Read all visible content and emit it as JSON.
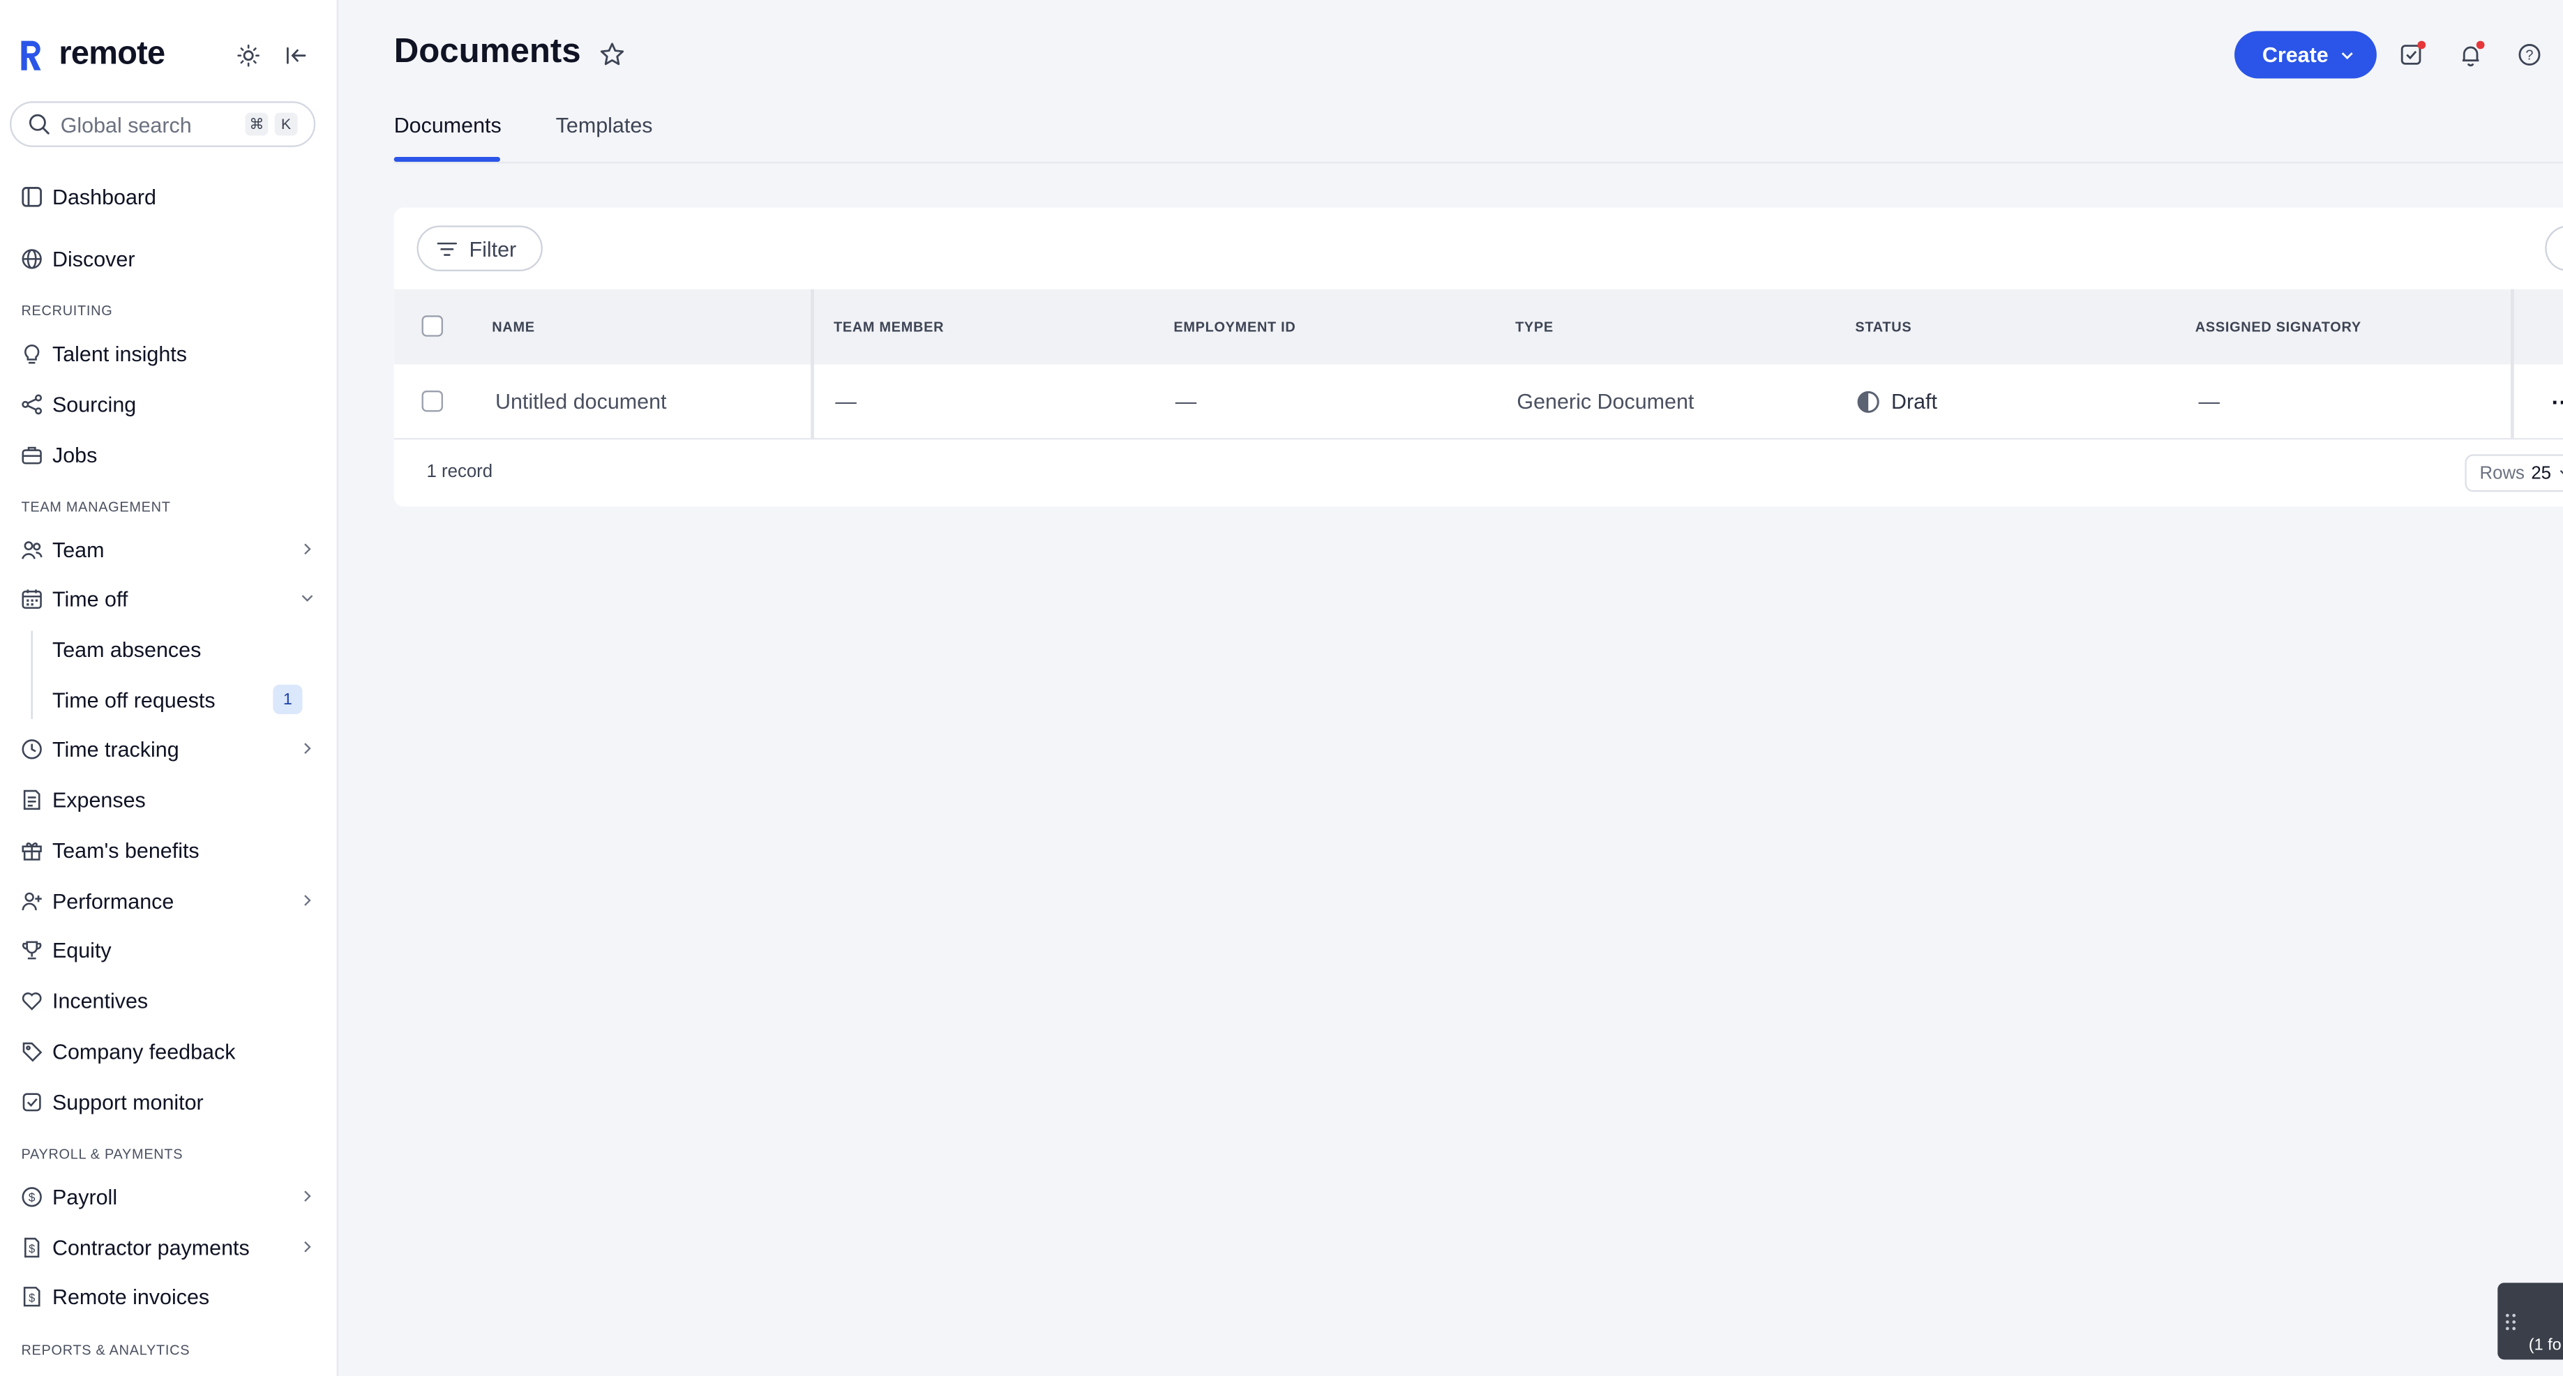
{
  "app": {
    "brand": "remote",
    "colors": {
      "accent": "#2a55e8",
      "sidebar_bg": "#ffffff",
      "page_bg": "#f4f5f8",
      "badge_bg": "#dbe7fb",
      "notification_dot": "#e5373a"
    }
  },
  "search": {
    "placeholder": "Global search",
    "shortcut_cmd": "⌘",
    "shortcut_key": "K"
  },
  "sidebar": {
    "top_items": [
      {
        "label": "Dashboard",
        "icon": "dashboard-icon"
      },
      {
        "label": "Discover",
        "icon": "globe-icon"
      }
    ],
    "sections": [
      {
        "title": "RECRUITING",
        "items": [
          {
            "label": "Talent insights",
            "icon": "lightbulb-icon"
          },
          {
            "label": "Sourcing",
            "icon": "share-icon"
          },
          {
            "label": "Jobs",
            "icon": "briefcase-icon"
          }
        ]
      },
      {
        "title": "TEAM MANAGEMENT",
        "items": [
          {
            "label": "Team",
            "icon": "people-icon",
            "chevron": "right"
          },
          {
            "label": "Time off",
            "icon": "calendar-icon",
            "chevron": "down",
            "expanded": true,
            "children": [
              {
                "label": "Team absences"
              },
              {
                "label": "Time off requests",
                "badge": "1"
              }
            ]
          },
          {
            "label": "Time tracking",
            "icon": "clock-icon",
            "chevron": "right"
          },
          {
            "label": "Expenses",
            "icon": "receipt-icon"
          },
          {
            "label": "Team's benefits",
            "icon": "gift-icon"
          },
          {
            "label": "Performance",
            "icon": "user-plus-icon",
            "chevron": "right"
          },
          {
            "label": "Equity",
            "icon": "trophy-icon"
          },
          {
            "label": "Incentives",
            "icon": "heart-icon"
          },
          {
            "label": "Company feedback",
            "icon": "tag-icon"
          },
          {
            "label": "Support monitor",
            "icon": "monitor-icon"
          }
        ]
      },
      {
        "title": "PAYROLL & PAYMENTS",
        "items": [
          {
            "label": "Payroll",
            "icon": "dollar-circle-icon",
            "chevron": "right"
          },
          {
            "label": "Contractor payments",
            "icon": "dollar-doc-icon",
            "chevron": "right"
          },
          {
            "label": "Remote invoices",
            "icon": "invoice-icon"
          }
        ]
      },
      {
        "title": "REPORTS & ANALYTICS",
        "items": []
      }
    ]
  },
  "header": {
    "title": "Documents",
    "create_label": "Create",
    "icons": [
      "star-icon",
      "tasks-icon",
      "bell-icon",
      "help-icon"
    ]
  },
  "tabs": [
    {
      "label": "Documents",
      "active": true
    },
    {
      "label": "Templates",
      "active": false
    }
  ],
  "table": {
    "filter_label": "Filter",
    "columns": [
      "NAME",
      "TEAM MEMBER",
      "EMPLOYMENT ID",
      "TYPE",
      "STATUS",
      "ASSIGNED SIGNATORY"
    ],
    "rows": [
      {
        "name": "Untitled document",
        "team_member": "—",
        "employment_id": "—",
        "type": "Generic Document",
        "status": "Draft",
        "assigned_signatory": "—"
      }
    ],
    "record_count": "1 record",
    "rows_label": "Rows",
    "rows_value": "25"
  },
  "floating_widget": {
    "text": "(1 fo"
  }
}
